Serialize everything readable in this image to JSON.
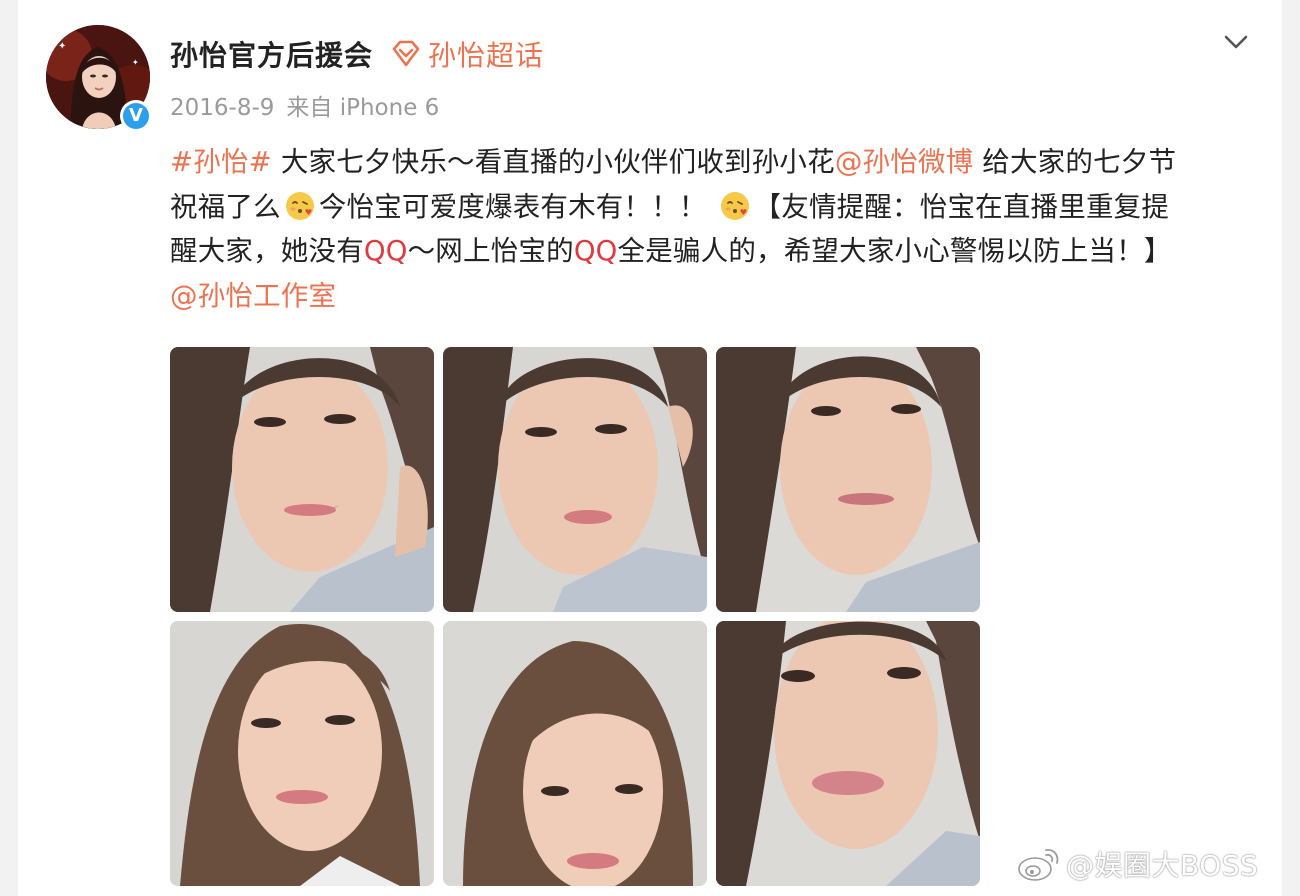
{
  "post": {
    "author": {
      "name": "孙怡官方后援会",
      "verified": true
    },
    "super_topic": {
      "label": "孙怡超话",
      "icon": "diamond-icon"
    },
    "meta": {
      "date": "2016-8-9",
      "source": "来自 iPhone 6"
    },
    "menu_icon": "chevron-down-icon",
    "content": {
      "hashtag": "#孙怡#",
      "text_1": " 大家七夕快乐～看直播的小伙伴们收到孙小花",
      "mention_1": "@孙怡微博",
      "text_2": " 给大家的七夕节",
      "text_3": "祝福了么",
      "text_4": "今怡宝可爱度爆表有木有！！！ ",
      "text_5": "【友情提醒：怡宝在直播里重复提",
      "text_6": "醒大家，她没有",
      "qq_1": "QQ",
      "text_7": "～网上怡宝的",
      "qq_2": "QQ",
      "text_8": "全是骗人的，希望大家小心警惕以防上当！】",
      "mention_2": "@孙怡工作室",
      "emoji": "blowing-kiss-emoji"
    },
    "photos": [
      {
        "alt": "selfie-1"
      },
      {
        "alt": "selfie-2"
      },
      {
        "alt": "selfie-3"
      },
      {
        "alt": "selfie-4"
      },
      {
        "alt": "selfie-5"
      },
      {
        "alt": "selfie-6"
      }
    ]
  },
  "watermark": {
    "text": "@娱圈大BOSS",
    "icon": "weibo-logo-icon"
  },
  "colors": {
    "accent": "#eb7350",
    "qq_red": "#e0393e",
    "verified_blue": "#2c9fea",
    "text": "#222222",
    "meta": "#9a9a9a"
  }
}
